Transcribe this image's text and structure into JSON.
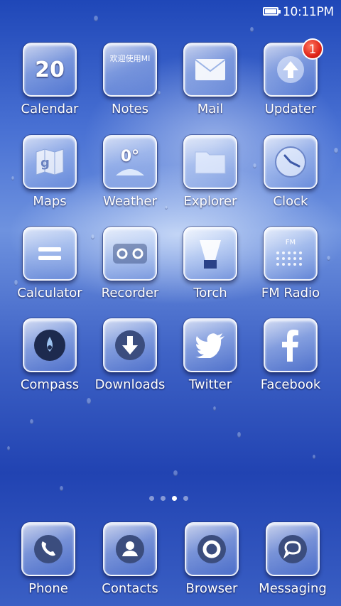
{
  "status_bar": {
    "time": "10:11PM",
    "battery_icon": "battery-icon"
  },
  "apps": [
    {
      "label": "Calendar",
      "icon": "calendar-icon",
      "date": "20"
    },
    {
      "label": "Notes",
      "icon": "notes-icon",
      "note_text": "欢迎使用MI"
    },
    {
      "label": "Mail",
      "icon": "mail-icon"
    },
    {
      "label": "Updater",
      "icon": "updater-icon",
      "badge": "1"
    },
    {
      "label": "Maps",
      "icon": "maps-icon"
    },
    {
      "label": "Weather",
      "icon": "weather-icon",
      "temperature": "0°"
    },
    {
      "label": "Explorer",
      "icon": "explorer-icon"
    },
    {
      "label": "Clock",
      "icon": "clock-icon"
    },
    {
      "label": "Calculator",
      "icon": "calculator-icon"
    },
    {
      "label": "Recorder",
      "icon": "recorder-icon"
    },
    {
      "label": "Torch",
      "icon": "torch-icon"
    },
    {
      "label": "FM Radio",
      "icon": "radio-icon",
      "radio_text": "FM"
    },
    {
      "label": "Compass",
      "icon": "compass-icon"
    },
    {
      "label": "Downloads",
      "icon": "downloads-icon"
    },
    {
      "label": "Twitter",
      "icon": "twitter-icon"
    },
    {
      "label": "Facebook",
      "icon": "facebook-icon"
    }
  ],
  "pager": {
    "count": 4,
    "active_index": 2
  },
  "dock": [
    {
      "label": "Phone",
      "icon": "phone-icon"
    },
    {
      "label": "Contacts",
      "icon": "contacts-icon"
    },
    {
      "label": "Browser",
      "icon": "browser-icon"
    },
    {
      "label": "Messaging",
      "icon": "messaging-icon"
    }
  ]
}
